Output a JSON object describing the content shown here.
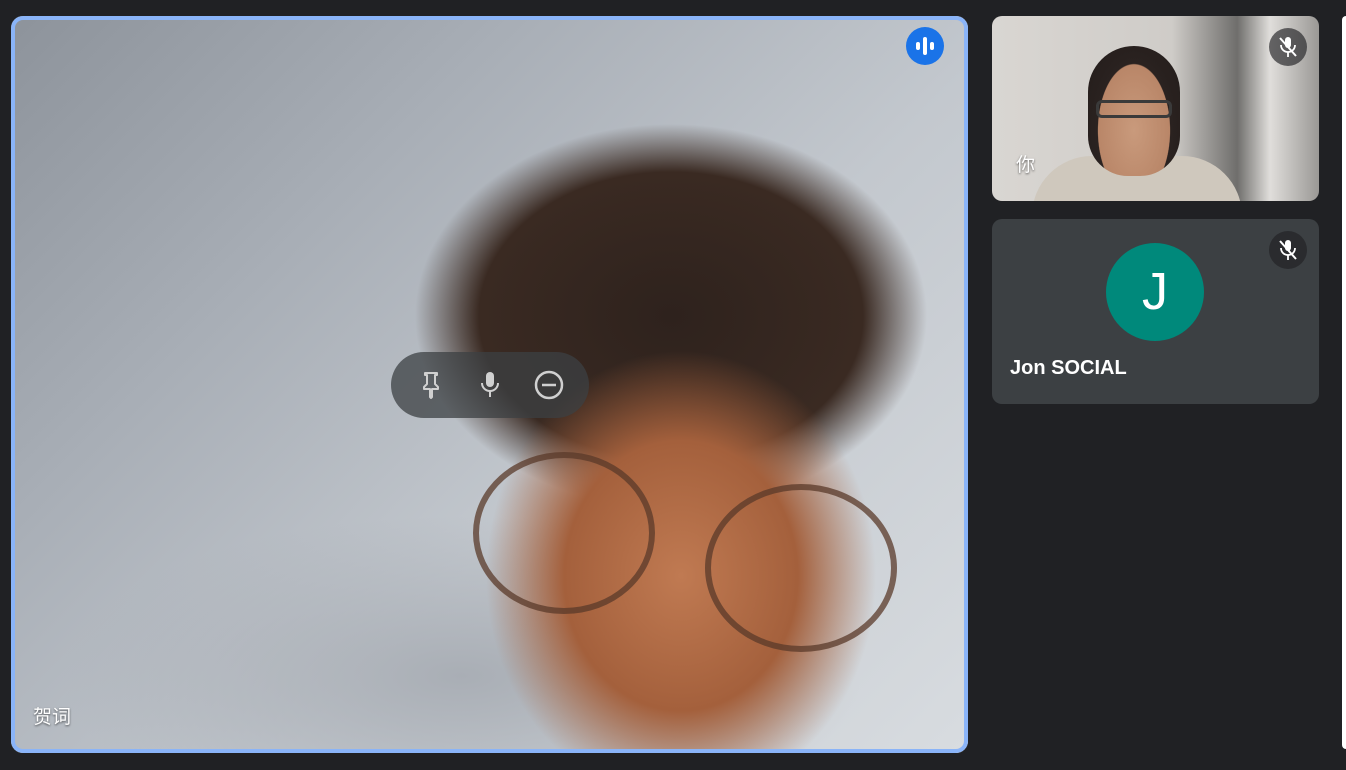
{
  "main_tile": {
    "participant_name": "贺词",
    "speaking_icon": "audio-wave-icon",
    "controls": [
      {
        "name": "pin-button",
        "icon": "pin-icon"
      },
      {
        "name": "mic-button",
        "icon": "mic-icon"
      },
      {
        "name": "remove-button",
        "icon": "minus-circle-icon"
      }
    ]
  },
  "self_tile": {
    "participant_name": "你",
    "muted_icon": "mic-off-icon"
  },
  "jon_tile": {
    "avatar_letter": "J",
    "participant_name": "Jon SOCIAL",
    "muted_icon": "mic-off-icon",
    "avatar_color": "#00897b"
  },
  "colors": {
    "background": "#202124",
    "active_speaker_border": "#8ab4f8",
    "speaking_badge": "#1a73e8",
    "tile_background": "#3c4043"
  }
}
